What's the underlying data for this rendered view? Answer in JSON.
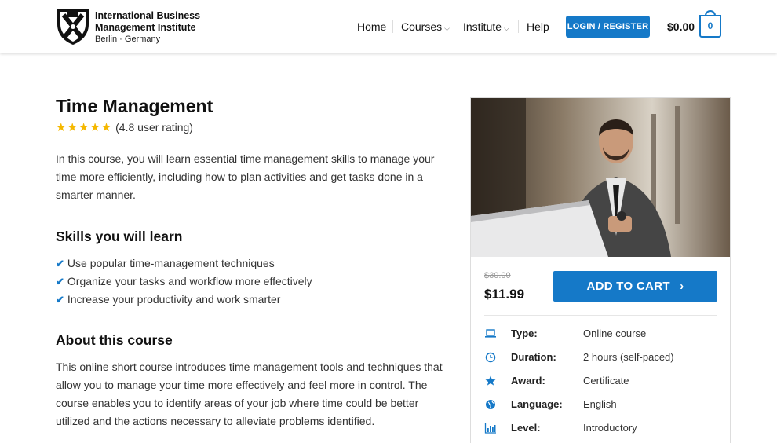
{
  "brand": {
    "line1": "International Business",
    "line2": "Management Institute",
    "line3": "Berlin · Germany"
  },
  "nav": {
    "home": "Home",
    "courses": "Courses",
    "institute": "Institute",
    "help": "Help",
    "login": "LOGIN / REGISTER",
    "cart_total": "$0.00",
    "cart_count": "0"
  },
  "course": {
    "title": "Time Management",
    "stars": "★★★★★",
    "rating_text": "(4.8 user rating)",
    "rating_value": 4.8,
    "intro": "In this course, you will learn essential time management skills to manage your time more efficiently, including how to plan activities and get tasks done in a smarter manner.",
    "skills_heading": "Skills you will learn",
    "skills": [
      "Use popular time-management techniques",
      "Organize your tasks and workflow more effectively",
      "Increase your productivity and work smarter"
    ],
    "about_heading": "About this course",
    "about": "This online short course introduces time management tools and techniques that allow you to manage your time more effectively and feel more in control. The course enables you to identify areas of your job where time could be better utilized and the actions necessary to alleviate problems identified."
  },
  "sidebar": {
    "old_price": "$30.00",
    "new_price": "$11.99",
    "add_to_cart": "ADD TO CART",
    "add_to_cart_arrow": "›",
    "details": [
      {
        "icon": "laptop-icon",
        "label": "Type:",
        "value": "Online course"
      },
      {
        "icon": "clock-icon",
        "label": "Duration:",
        "value": "2 hours (self-paced)"
      },
      {
        "icon": "star-icon",
        "label": "Award:",
        "value": "Certificate"
      },
      {
        "icon": "globe-icon",
        "label": "Language:",
        "value": "English"
      },
      {
        "icon": "bar-chart-icon",
        "label": "Level:",
        "value": "Introductory"
      }
    ]
  },
  "colors": {
    "accent": "#1579c8",
    "star": "#f5b800"
  }
}
